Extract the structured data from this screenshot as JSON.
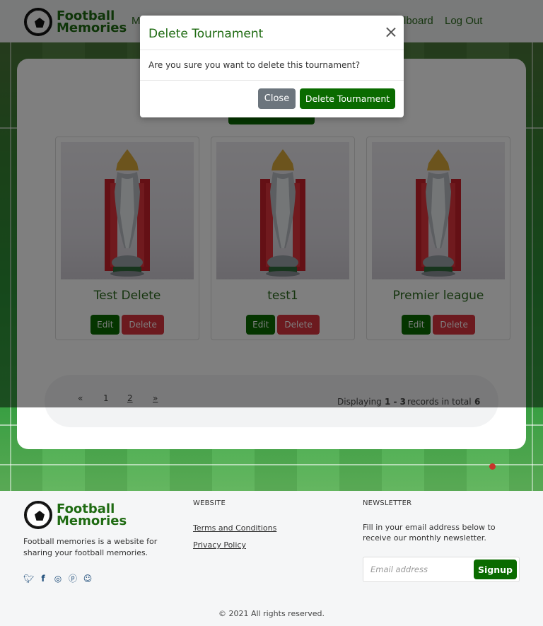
{
  "brand": {
    "line1": "Football",
    "line2": "Memories"
  },
  "nav": {
    "item_partial": "M",
    "leaderboard_partial": "lboard",
    "logout": "Log Out"
  },
  "modal": {
    "title": "Delete Tournament",
    "message": "Are you sure you want to delete this tournament?",
    "close_label": "Close",
    "confirm_label": "Delete Tournament"
  },
  "tournaments": [
    {
      "name": "Test Delete",
      "edit_label": "Edit",
      "delete_label": "Delete"
    },
    {
      "name": "test1",
      "edit_label": "Edit",
      "delete_label": "Delete"
    },
    {
      "name": "Premier league",
      "edit_label": "Edit",
      "delete_label": "Delete"
    }
  ],
  "pagination": {
    "prev": "«",
    "page1": "1",
    "page2": "2",
    "next": "»",
    "displaying": "Displaying",
    "range": "1 - 3",
    "records_in_total": "records in total",
    "total": "6"
  },
  "footer": {
    "description": "Football memories is a website for sharing your football memories.",
    "website_heading": "WEBSITE",
    "terms": "Terms and Conditions",
    "privacy": "Privacy Policy",
    "newsletter_heading": "NEWSLETTER",
    "newsletter_text": "Fill in your email address below to receive our monthly newsletter.",
    "email_placeholder": "Email address",
    "signup": "Signup",
    "copyright": "© 2021 All rights reserved.",
    "social_icons": [
      "twitter-icon",
      "facebook-icon",
      "instagram-icon",
      "pinterest-icon",
      "snapchat-icon"
    ]
  },
  "colors": {
    "brand_green": "#0a6b00",
    "danger": "#d8343f",
    "secondary": "#6c757d"
  }
}
